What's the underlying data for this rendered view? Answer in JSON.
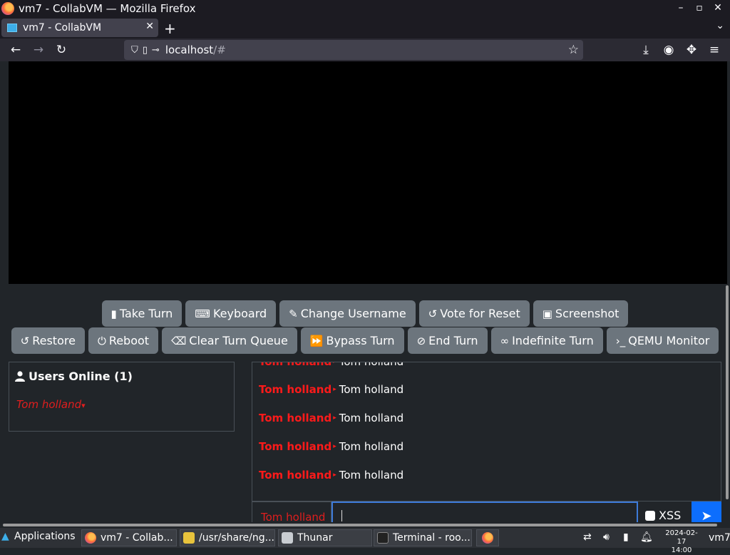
{
  "window": {
    "title": "vm7 - CollabVM — Mozilla Firefox",
    "min": "–",
    "max": "▫",
    "close": "✕"
  },
  "browser": {
    "tab_title": "vm7 - CollabVM",
    "tab_close": "✕",
    "new_tab": "+",
    "tab_list": "⌄",
    "url_host": "localhost",
    "url_rest": "/#",
    "back": "←",
    "forward": "→",
    "reload": "↻",
    "star": "☆",
    "downloads": "⤓",
    "account": "◉",
    "extensions": "✥",
    "menu": "≡"
  },
  "vm_buttons_row1": [
    {
      "icon": "▮",
      "label": "Take Turn"
    },
    {
      "icon": "⌨",
      "label": "Keyboard"
    },
    {
      "icon": "✎",
      "label": "Change Username"
    },
    {
      "icon": "↺",
      "label": "Vote for Reset"
    },
    {
      "icon": "▣",
      "label": "Screenshot"
    }
  ],
  "vm_buttons_row2": [
    {
      "icon": "↺",
      "label": "Restore"
    },
    {
      "icon": "⏻",
      "label": "Reboot"
    },
    {
      "icon": "⌫",
      "label": "Clear Turn Queue"
    },
    {
      "icon": "⏩",
      "label": "Bypass Turn"
    },
    {
      "icon": "⊘",
      "label": "End Turn"
    },
    {
      "icon": "∞",
      "label": "Indefinite Turn"
    },
    {
      "icon": "›_",
      "label": "QEMU Monitor"
    }
  ],
  "users": {
    "heading": "Users Online (1)",
    "list": [
      "Tom holland"
    ],
    "caret": "▾"
  },
  "chat": {
    "messages": [
      {
        "user": "Tom holland",
        "text": "Tom holland"
      },
      {
        "user": "Tom holland",
        "text": "Tom holland"
      },
      {
        "user": "Tom holland",
        "text": "Tom holland"
      },
      {
        "user": "Tom holland",
        "text": "Tom holland"
      },
      {
        "user": "Tom holland",
        "text": "Tom holland"
      }
    ],
    "input_username": "Tom holland",
    "input_value": "",
    "xss_label": "XSS",
    "send_icon": "➤"
  },
  "taskbar": {
    "apps_label": "Applications",
    "items": [
      "vm7 - Collab...",
      "/usr/share/ng...",
      "Thunar",
      "Terminal - roo..."
    ],
    "clock_date": "2024-02-17",
    "clock_time": "14:00",
    "vm_label": "vm7"
  }
}
